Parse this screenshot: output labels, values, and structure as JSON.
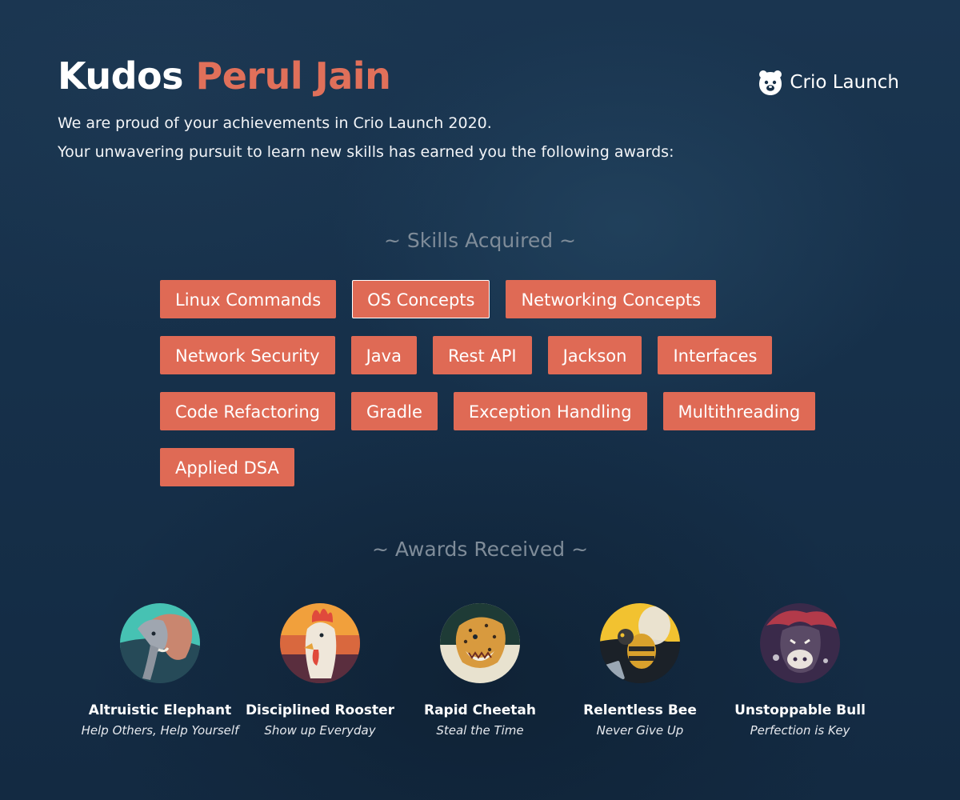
{
  "header": {
    "kudos": "Kudos",
    "name": "Perul Jain",
    "line1": "We are proud of your achievements in Crio Launch 2020.",
    "line2": "Your unwavering pursuit to learn new skills has earned you the following awards:"
  },
  "brand": {
    "icon": "bear-logo-icon",
    "text": "Crio Launch"
  },
  "skills": {
    "heading": "~ Skills Acquired ~",
    "items": [
      "Linux Commands",
      "OS Concepts",
      "Networking Concepts",
      "Network Security",
      "Java",
      "Rest API",
      "Jackson",
      "Interfaces",
      "Code Refactoring",
      "Gradle",
      "Exception Handling",
      "Multithreading",
      "Applied DSA"
    ]
  },
  "awards": {
    "heading": "~ Awards Received ~",
    "items": [
      {
        "name": "Altruistic Elephant",
        "motto": "Help Others, Help Yourself",
        "icon": "elephant-icon"
      },
      {
        "name": "Disciplined Rooster",
        "motto": "Show up Everyday",
        "icon": "rooster-icon"
      },
      {
        "name": "Rapid Cheetah",
        "motto": "Steal the Time",
        "icon": "cheetah-icon"
      },
      {
        "name": "Relentless Bee",
        "motto": "Never Give Up",
        "icon": "bee-icon"
      },
      {
        "name": "Unstoppable Bull",
        "motto": "Perfection is Key",
        "icon": "bull-icon"
      }
    ]
  },
  "colors": {
    "accent": "#df6a55",
    "background": "#173048",
    "heading_muted": "#7f8c99"
  }
}
